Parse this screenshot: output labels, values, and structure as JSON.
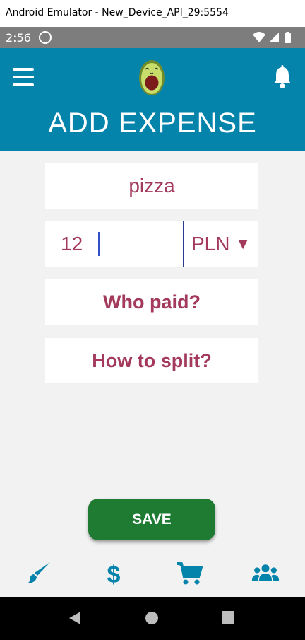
{
  "window": {
    "title": "Android Emulator - New_Device_API_29:5554"
  },
  "status_bar": {
    "time": "2:56"
  },
  "app_bar": {
    "title": "ADD EXPENSE"
  },
  "form": {
    "description_value": "pizza",
    "amount_value": "12",
    "currency_label": "PLN",
    "currency_arrow": "▼",
    "who_paid_label": "Who paid?",
    "how_to_split_label": "How to split?",
    "save_label": "SAVE"
  },
  "bottom_nav": {
    "items": [
      "brush-icon",
      "dollar-icon",
      "cart-icon",
      "group-icon"
    ]
  },
  "colors": {
    "primary": "#0483ab",
    "accent_text": "#a33a5c",
    "save": "#1f7a32",
    "background": "#f2f2f2"
  }
}
